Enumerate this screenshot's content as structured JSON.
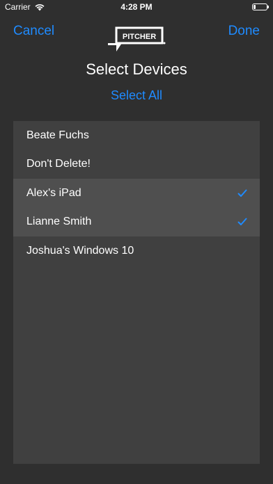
{
  "status_bar": {
    "carrier": "Carrier",
    "time": "4:28 PM",
    "wifi_icon": "wifi-icon",
    "battery_icon": "battery-icon"
  },
  "nav": {
    "cancel_label": "Cancel",
    "done_label": "Done",
    "logo_text": "PITCHER"
  },
  "title": "Select Devices",
  "select_all_label": "Select All",
  "accent_color": "#1f8bff",
  "devices": [
    {
      "name": "Beate Fuchs",
      "selected": false
    },
    {
      "name": "Don't Delete!",
      "selected": false
    },
    {
      "name": "Alex's iPad",
      "selected": true
    },
    {
      "name": "Lianne Smith",
      "selected": true
    },
    {
      "name": "Joshua's Windows 10",
      "selected": false
    }
  ]
}
